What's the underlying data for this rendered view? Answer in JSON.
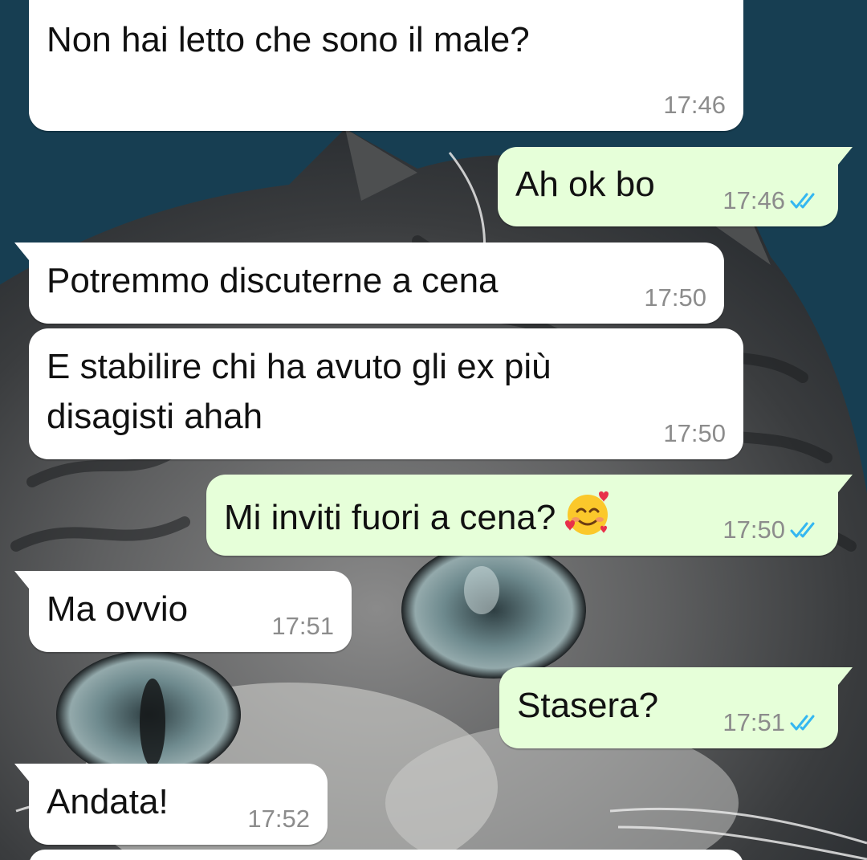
{
  "chat": {
    "messages": [
      {
        "direction": "incoming",
        "text": "Non hai letto che sono il male?",
        "time": "17:46"
      },
      {
        "direction": "outgoing",
        "text": "Ah ok bo",
        "time": "17:46",
        "status": "read"
      },
      {
        "direction": "incoming",
        "text": "Potremmo discuterne a cena",
        "time": "17:50"
      },
      {
        "direction": "incoming",
        "text_line1": "E stabilire chi ha avuto gli ex più",
        "text_line2": "disagisti ahah",
        "time": "17:50"
      },
      {
        "direction": "outgoing",
        "text": "Mi inviti fuori a cena?",
        "emoji": "smiling-face-with-hearts",
        "time": "17:50",
        "status": "read"
      },
      {
        "direction": "incoming",
        "text": "Ma ovvio",
        "time": "17:51"
      },
      {
        "direction": "outgoing",
        "text": "Stasera?",
        "time": "17:51",
        "status": "read"
      },
      {
        "direction": "incoming",
        "text": "Andata!",
        "time": "17:52"
      }
    ]
  },
  "colors": {
    "incoming_bubble": "#ffffff",
    "outgoing_bubble": "#e6ffd9",
    "read_ticks": "#34b7f1",
    "timestamp": "#8c8c8c",
    "wallpaper": "#173e52"
  },
  "icons": {
    "read_receipt": "double-check-icon",
    "wallpaper": "kitten-photo"
  }
}
